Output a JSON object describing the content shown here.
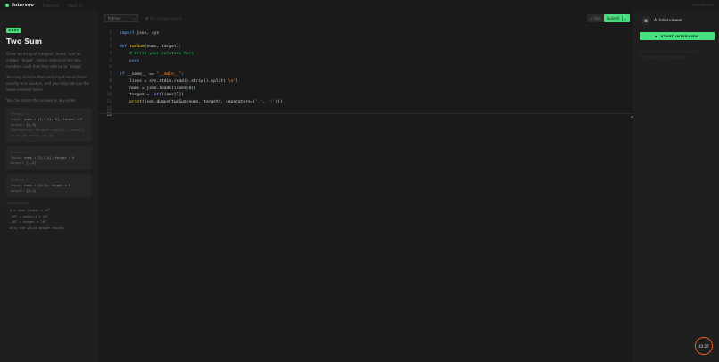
{
  "app": {
    "brand": "Intervoo",
    "nav": [
      "Problems",
      "Mock AI"
    ],
    "top_right": "Exit session"
  },
  "problem": {
    "difficulty": "EASY",
    "title": "Two Sum",
    "description": [
      "Given an array of integers `nums` and an integer `target`, return indices of the two numbers such that they add up to `target`.",
      "You may assume that each input would have exactly one solution, and you may not use the same element twice.",
      "You can return the answer in any order."
    ],
    "examples": [
      {
        "title": "Example 1",
        "input_label": "Input:",
        "input": "nums = [2,7,11,15], target = 9",
        "output_label": "Output:",
        "output": "[0,1]",
        "explanation": "Explanation: Because nums[0] + nums[1] == 9, we return [0, 1]."
      },
      {
        "title": "Example 2",
        "input_label": "Input:",
        "input": "nums = [3,2,4], target = 6",
        "output_label": "Output:",
        "output": "[1,2]"
      },
      {
        "title": "Example 3",
        "input_label": "Input:",
        "input": "nums = [3,3], target = 6",
        "output_label": "Output:",
        "output": "[0,1]"
      }
    ],
    "constraints_title": "Constraints:",
    "constraints": [
      "2 ≤ nums.length ≤ 10⁴",
      "-10⁹ ≤ nums[i] ≤ 10⁹",
      "-10⁹ ≤ target ≤ 10⁹",
      "Only one valid answer exists."
    ]
  },
  "editor": {
    "language": "Python",
    "autosave": "All changes saved",
    "run_label": "▷ Run",
    "submit_label": "Submit",
    "line_numbers": [
      "1",
      "2",
      "3",
      "4",
      "5",
      "6",
      "7",
      "8",
      "9",
      "10",
      "11",
      "12",
      "13"
    ]
  },
  "interviewer": {
    "avatar": "N",
    "name": "AI Interviewer",
    "start_label": "START INTERVIEW",
    "note": "Start the interview to talk with your AI interviewer about this problem."
  },
  "timer": "43:27",
  "colors": {
    "accent": "#4ade80",
    "timer_ring": "#e85d2a"
  },
  "icons": {
    "play": "play-icon",
    "chevron": "chevron-down-icon"
  }
}
